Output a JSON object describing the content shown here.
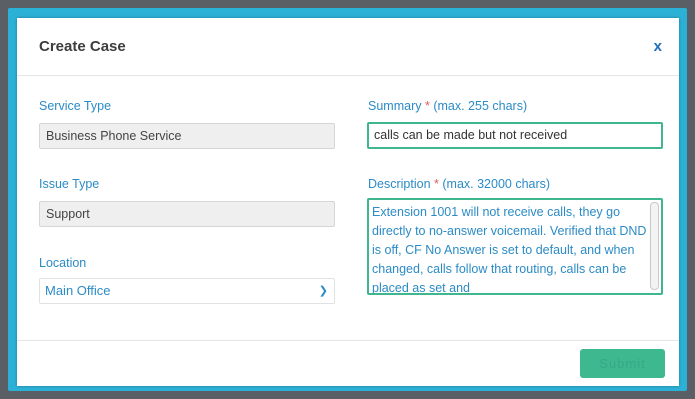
{
  "modal": {
    "title": "Create Case",
    "close_label": "x"
  },
  "form": {
    "service_type": {
      "label": "Service Type",
      "value": "Business Phone Service"
    },
    "issue_type": {
      "label": "Issue Type",
      "value": "Support"
    },
    "location": {
      "label": "Location",
      "value": "Main Office"
    },
    "summary": {
      "label": "Summary",
      "required_mark": "*",
      "hint": "(max. 255 chars)",
      "value": "calls can be made but not received"
    },
    "description": {
      "label": "Description",
      "required_mark": "*",
      "hint": "(max. 32000 chars)",
      "value": "Extension 1001 will not receive calls, they go directly to no-answer voicemail. Verified that DND is off, CF No Answer is set to default, and when changed, calls follow that routing, calls can be placed as set and"
    }
  },
  "footer": {
    "submit_label": "Submit"
  },
  "colors": {
    "accent": "#2b8bc6",
    "submit": "#3db88f",
    "frame": "#2cb1d6"
  },
  "icons": {
    "location_dropdown": "chevron-down-icon"
  }
}
